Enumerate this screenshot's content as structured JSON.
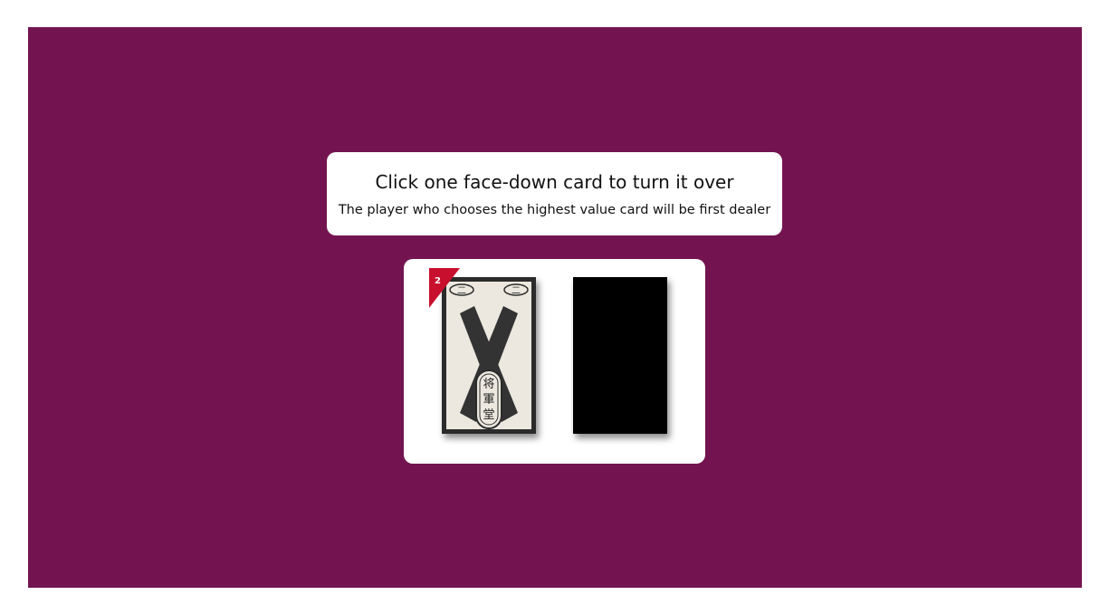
{
  "prompt": {
    "title": "Click one face-down card to turn it over",
    "subtitle": "The player who chooses the highest value card will be first dealer"
  },
  "cards": {
    "revealed": {
      "badge_value": "2",
      "top_left_mark": "二",
      "top_right_mark": "二",
      "stamp_chars": [
        "将",
        "軍",
        "堂"
      ]
    },
    "hidden": {
      "state": "face-down"
    }
  },
  "colors": {
    "table": "#731450",
    "badge": "#c8102e",
    "card_back": "#000000"
  }
}
